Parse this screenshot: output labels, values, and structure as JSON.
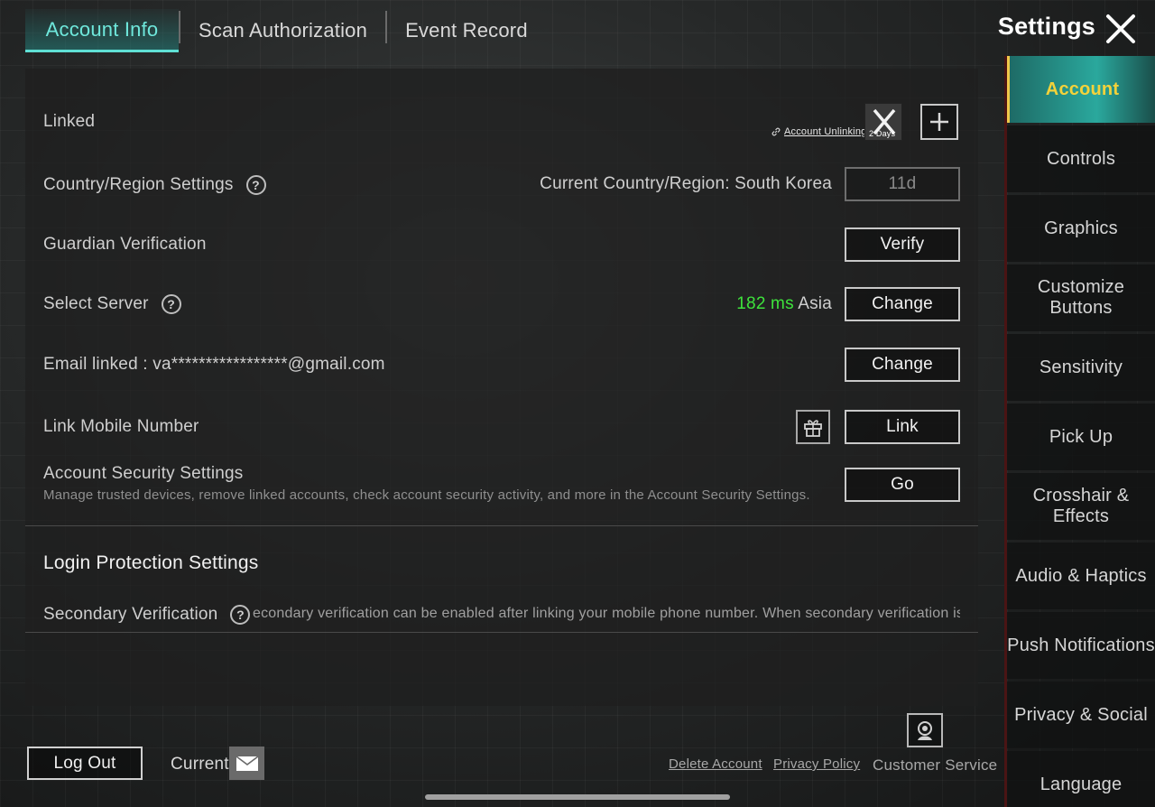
{
  "tabs": [
    {
      "label": "Account Info",
      "active": true
    },
    {
      "label": "Scan Authorization",
      "active": false
    },
    {
      "label": "Event Record",
      "active": false
    }
  ],
  "settings_title": "Settings",
  "sidebar": {
    "items": [
      {
        "label": "Account",
        "active": true
      },
      {
        "label": "Controls"
      },
      {
        "label": "Graphics"
      },
      {
        "label": "Customize Buttons"
      },
      {
        "label": "Sensitivity"
      },
      {
        "label": "Pick Up"
      },
      {
        "label": "Crosshair & Effects"
      },
      {
        "label": "Audio & Haptics"
      },
      {
        "label": "Push Notifications"
      },
      {
        "label": "Privacy & Social"
      },
      {
        "label": "Language"
      }
    ]
  },
  "account": {
    "linked": {
      "label": "Linked",
      "unlink_label": "Account Unlinking",
      "x_badge": "2 Days"
    },
    "region": {
      "label": "Country/Region Settings",
      "current": "Current Country/Region: South Korea",
      "button": "11d"
    },
    "guardian": {
      "label": "Guardian Verification",
      "button": "Verify"
    },
    "server": {
      "label": "Select Server",
      "ping": "182 ms",
      "region": "Asia",
      "button": "Change"
    },
    "email": {
      "label": "Email linked : va*****************@gmail.com",
      "button": "Change"
    },
    "mobile": {
      "label": "Link Mobile Number",
      "button": "Link"
    },
    "security": {
      "label": "Account Security Settings",
      "description": "Manage trusted devices, remove linked accounts, check account security activity, and more in the Account Security Settings.",
      "button": "Go"
    }
  },
  "login_protection": {
    "title": "Login Protection Settings",
    "secondary_label": "Secondary Verification",
    "secondary_text": "econdary verification can be enabled after linking your mobile phone number. When secondary verification is enabled, non-t"
  },
  "footer": {
    "logout": "Log Out",
    "current": "Current",
    "delete_account": "Delete Account",
    "privacy_policy": "Privacy Policy",
    "customer_service": "Customer Service"
  },
  "colors": {
    "accent_teal": "#5fe0d5",
    "active_yellow": "#f4d23a",
    "ping_green": "#3ee33c"
  }
}
